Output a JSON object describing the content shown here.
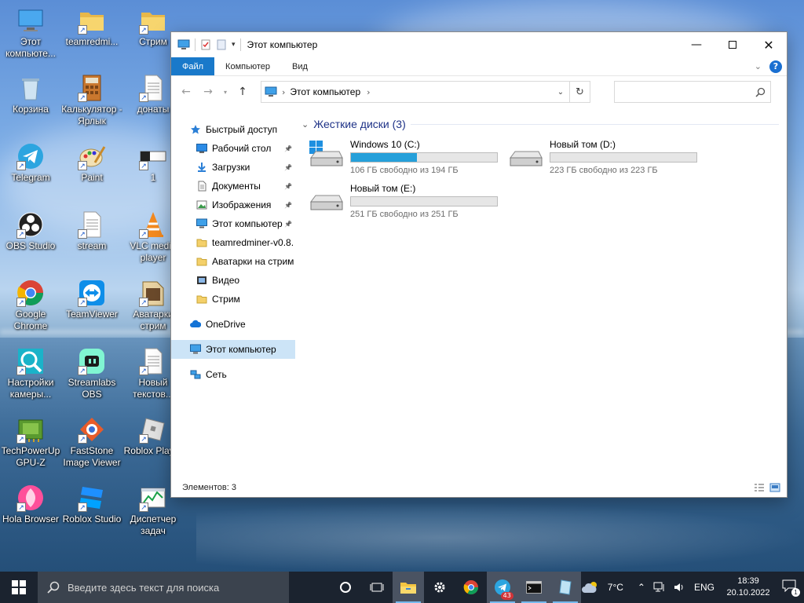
{
  "desktop": {
    "icons": [
      {
        "label": "Этот компьюте...",
        "icon": "this-pc-icon"
      },
      {
        "label": "teamredmi...",
        "icon": "folder-icon"
      },
      {
        "label": "Стрим",
        "icon": "folder-icon"
      },
      {
        "label": "Корзина",
        "icon": "recycle-bin-icon"
      },
      {
        "label": "Калькулятор - Ярлык",
        "icon": "calculator-icon"
      },
      {
        "label": "донаты",
        "icon": "text-document-icon"
      },
      {
        "label": "Telegram",
        "icon": "telegram-icon"
      },
      {
        "label": "Paint",
        "icon": "paint-icon"
      },
      {
        "label": "1",
        "icon": "image-file-icon"
      },
      {
        "label": "OBS Studio",
        "icon": "obs-icon"
      },
      {
        "label": "stream",
        "icon": "text-document-icon"
      },
      {
        "label": "VLC media player",
        "icon": "vlc-icon"
      },
      {
        "label": "Google Chrome",
        "icon": "chrome-icon"
      },
      {
        "label": "TeamViewer",
        "icon": "teamviewer-icon"
      },
      {
        "label": "Аватарки стрим",
        "icon": "image-folder-icon"
      },
      {
        "label": "Настройки камеры...",
        "icon": "camera-settings-icon"
      },
      {
        "label": "Streamlabs OBS",
        "icon": "streamlabs-icon"
      },
      {
        "label": "Новый текстов...",
        "icon": "text-document-icon"
      },
      {
        "label": "TechPowerUp GPU-Z",
        "icon": "gpuz-icon"
      },
      {
        "label": "FastStone Image Viewer",
        "icon": "faststone-icon"
      },
      {
        "label": "Roblox Player",
        "icon": "roblox-icon"
      },
      {
        "label": "Hola Browser",
        "icon": "hola-icon"
      },
      {
        "label": "Roblox Studio",
        "icon": "roblox-studio-icon"
      },
      {
        "label": "Диспетчер задач",
        "icon": "task-manager-icon"
      }
    ]
  },
  "window": {
    "title": "Этот компьютер",
    "ribbon_tabs": [
      "Файл",
      "Компьютер",
      "Вид"
    ],
    "address": {
      "crumb": "Этот компьютер"
    },
    "nav": {
      "quick_access": "Быстрый доступ",
      "quick_items": [
        {
          "label": "Рабочий стол",
          "pinned": true
        },
        {
          "label": "Загрузки",
          "pinned": true
        },
        {
          "label": "Документы",
          "pinned": true
        },
        {
          "label": "Изображения",
          "pinned": true
        },
        {
          "label": "Этот компьютер",
          "pinned": true
        },
        {
          "label": "teamredminer-v0.8.",
          "pinned": false
        },
        {
          "label": "Аватарки на стрим",
          "pinned": false
        },
        {
          "label": "Видео",
          "pinned": false
        },
        {
          "label": "Стрим",
          "pinned": false
        }
      ],
      "onedrive": "OneDrive",
      "this_pc": "Этот компьютер",
      "network": "Сеть"
    },
    "group_title": "Жесткие диски (3)",
    "drives": [
      {
        "name": "Windows 10 (C:)",
        "free_text": "106 ГБ свободно из 194 ГБ",
        "used_fraction": 0.45,
        "system": true
      },
      {
        "name": "Новый том (D:)",
        "free_text": "223 ГБ свободно из 223 ГБ",
        "used_fraction": 0.0,
        "system": false
      },
      {
        "name": "Новый том (E:)",
        "free_text": "251 ГБ свободно из 251 ГБ",
        "used_fraction": 0.0,
        "system": false
      }
    ],
    "status": "Элементов: 3"
  },
  "taskbar": {
    "search_placeholder": "Введите здесь текст для поиска",
    "telegram_badge": "43",
    "weather": "7°C",
    "language": "ENG",
    "time": "18:39",
    "date": "20.10.2022",
    "notifications": "1"
  },
  "colors": {
    "accent": "#1979ca",
    "drive_fill": "#26a0da",
    "selection": "#cce4f7",
    "taskbar": "#1b232f"
  }
}
